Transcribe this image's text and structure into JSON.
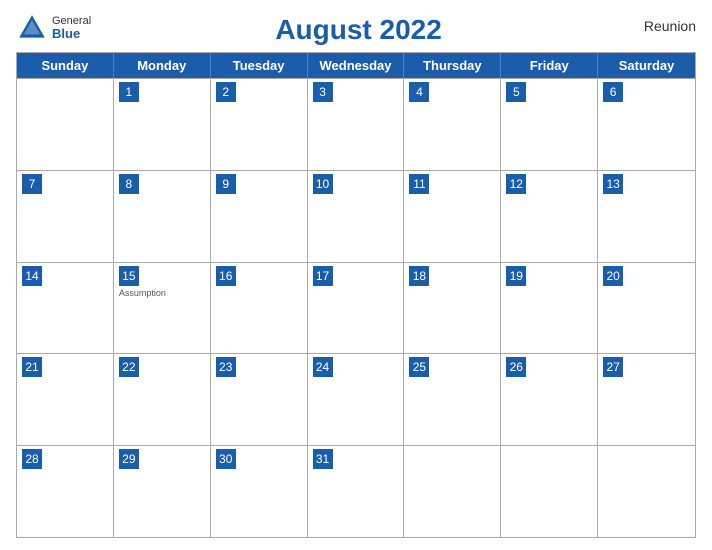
{
  "header": {
    "logo": {
      "general": "General",
      "blue": "Blue"
    },
    "title": "August 2022",
    "region": "Reunion"
  },
  "days": [
    "Sunday",
    "Monday",
    "Tuesday",
    "Wednesday",
    "Thursday",
    "Friday",
    "Saturday"
  ],
  "weeks": [
    [
      {
        "num": "",
        "holiday": ""
      },
      {
        "num": "1",
        "holiday": ""
      },
      {
        "num": "2",
        "holiday": ""
      },
      {
        "num": "3",
        "holiday": ""
      },
      {
        "num": "4",
        "holiday": ""
      },
      {
        "num": "5",
        "holiday": ""
      },
      {
        "num": "6",
        "holiday": ""
      }
    ],
    [
      {
        "num": "7",
        "holiday": ""
      },
      {
        "num": "8",
        "holiday": ""
      },
      {
        "num": "9",
        "holiday": ""
      },
      {
        "num": "10",
        "holiday": ""
      },
      {
        "num": "11",
        "holiday": ""
      },
      {
        "num": "12",
        "holiday": ""
      },
      {
        "num": "13",
        "holiday": ""
      }
    ],
    [
      {
        "num": "14",
        "holiday": ""
      },
      {
        "num": "15",
        "holiday": "Assumption"
      },
      {
        "num": "16",
        "holiday": ""
      },
      {
        "num": "17",
        "holiday": ""
      },
      {
        "num": "18",
        "holiday": ""
      },
      {
        "num": "19",
        "holiday": ""
      },
      {
        "num": "20",
        "holiday": ""
      }
    ],
    [
      {
        "num": "21",
        "holiday": ""
      },
      {
        "num": "22",
        "holiday": ""
      },
      {
        "num": "23",
        "holiday": ""
      },
      {
        "num": "24",
        "holiday": ""
      },
      {
        "num": "25",
        "holiday": ""
      },
      {
        "num": "26",
        "holiday": ""
      },
      {
        "num": "27",
        "holiday": ""
      }
    ],
    [
      {
        "num": "28",
        "holiday": ""
      },
      {
        "num": "29",
        "holiday": ""
      },
      {
        "num": "30",
        "holiday": ""
      },
      {
        "num": "31",
        "holiday": ""
      },
      {
        "num": "",
        "holiday": ""
      },
      {
        "num": "",
        "holiday": ""
      },
      {
        "num": "",
        "holiday": ""
      }
    ]
  ]
}
